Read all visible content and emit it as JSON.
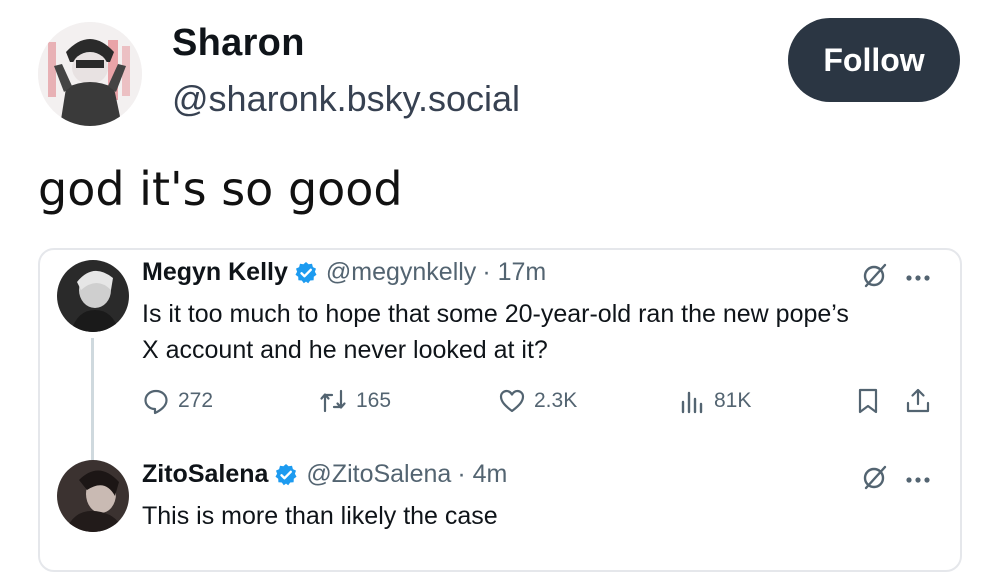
{
  "profile": {
    "display_name": "Sharon",
    "handle": "@sharonk.bsky.social",
    "follow_label": "Follow"
  },
  "post": {
    "text": "god it's so good"
  },
  "quoted_tweet": {
    "name": "Megyn Kelly",
    "handle": "@megynkelly",
    "time": "· 17m",
    "text_line1": "Is it too much to hope that some 20-year-old ran the new pope’s",
    "text_line2": "X account and he never looked at it?",
    "stats": {
      "replies": "272",
      "reposts": "165",
      "likes": "2.3K",
      "views": "81K"
    }
  },
  "reply_tweet": {
    "name": "ZitoSalena",
    "handle": "@ZitoSalena",
    "time": "· 4m",
    "text": "This is more than likely the case"
  },
  "colors": {
    "follow_button": "#2b3643",
    "verified_blue": "#1d9bf0",
    "muted_text": "#536471"
  }
}
